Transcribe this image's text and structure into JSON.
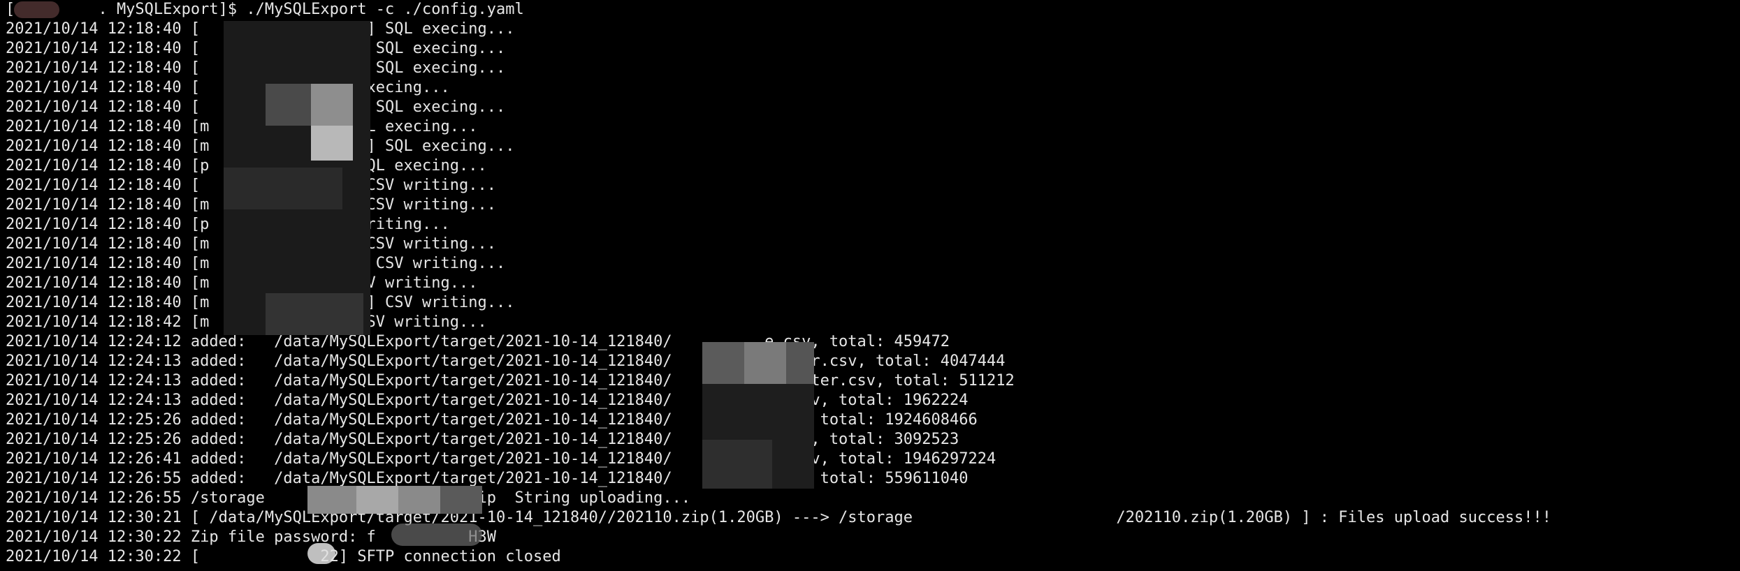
{
  "terminal": {
    "background": "#000000",
    "foreground": "#e6e6e6",
    "lines": [
      "[         . MySQLExport]$ ./MySQLExport -c ./config.yaml",
      "2021/10/14 12:18:40 [              .csv] SQL execing...",
      "2021/10/14 12:18:40 [          ter.csv] SQL execing...",
      "2021/10/14 12:18:40 [             .csv] SQL execing...",
      "2021/10/14 12:18:40 [               L execing...",
      "2021/10/14 12:18:40 [              csv] SQL execing...",
      "2021/10/14 12:18:40 [m           sv] SQL execing...",
      "2021/10/14 12:18:40 [m              csv] SQL execing...",
      "2021/10/14 12:18:40 [p          .csv] SQL execing...",
      "2021/10/14 12:18:40 [            .csv] CSV writing...",
      "2021/10/14 12:18:40 [m         nt.csv] CSV writing...",
      "2021/10/14 12:18:40 [p            CSV writing...",
      "2021/10/14 12:18:40 [m          r.csv] CSV writing...",
      "2021/10/14 12:18:40 [m        ster.csv] CSV writing...",
      "2021/10/14 12:18:40 [m          csv] CSV writing...",
      "2021/10/14 12:18:40 [m         ster.csv] CSV writing...",
      "2021/10/14 12:18:42 [m          .csv] CSV writing...",
      "2021/10/14 12:24:12 added:   /data/MySQLExport/target/2021-10-14_121840/          e.csv, total: 459472",
      "2021/10/14 12:24:13 added:   /data/MySQLExport/target/2021-10-14_121840/          master.csv, total: 4047444",
      "2021/10/14 12:24:13 added:   /data/MySQLExport/target/2021-10-14_121840/          q_master.csv, total: 511212",
      "2021/10/14 12:24:13 added:   /data/MySQLExport/target/2021-10-14_121840/          er.csv, total: 1962224",
      "2021/10/14 12:25:26 added:   /data/MySQLExport/target/2021-10-14_121840/          .csv, total: 1924608466",
      "2021/10/14 12:25:26 added:   /data/MySQLExport/target/2021-10-14_121840/          e.csv, total: 3092523",
      "2021/10/14 12:26:41 added:   /data/MySQLExport/target/2021-10-14_121840/          nt.csv, total: 1946297224",
      "2021/10/14 12:26:55 added:   /data/MySQLExport/target/2021-10-14_121840/          .csv, total: 559611040",
      "2021/10/14 12:26:55 /storage              /202110.zip  String uploading...",
      "2021/10/14 12:30:21 [ /data/MySQLExport/target/2021-10-14_121840//202110.zip(1.20GB) ---> /storage                      /202110.zip(1.20GB) ] : Files upload success!!!",
      "2021/10/14 12:30:22 Zip file password: f          H3W",
      "2021/10/14 12:30:22 [             22] SFTP connection closed"
    ]
  }
}
